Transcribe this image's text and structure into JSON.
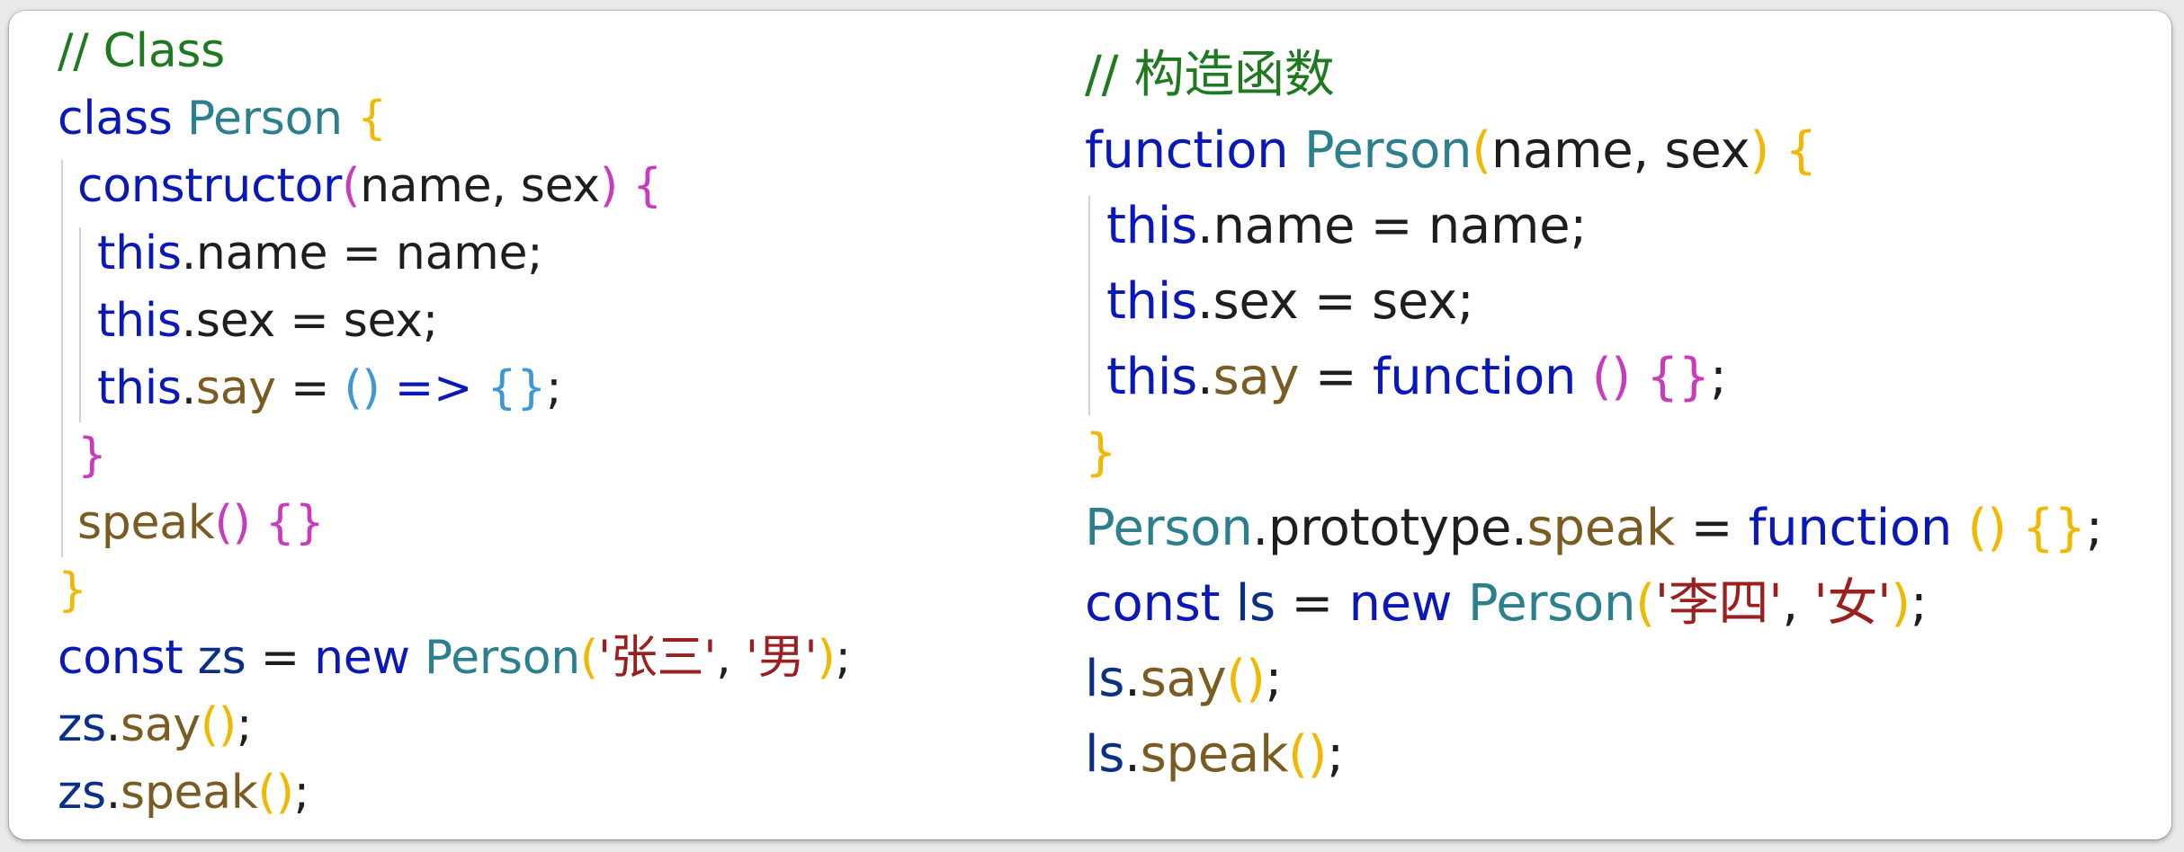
{
  "left_code": [
    {
      "indent": 0,
      "tokens": [
        {
          "t": "// Class",
          "c": "comment"
        }
      ]
    },
    {
      "indent": 0,
      "tokens": [
        {
          "t": "class ",
          "c": "keyword"
        },
        {
          "t": "Person ",
          "c": "class"
        },
        {
          "t": "{",
          "c": "brace-gold"
        }
      ]
    },
    {
      "indent": 1,
      "tokens": [
        {
          "t": "constructor",
          "c": "keyword"
        },
        {
          "t": "(",
          "c": "brace-pink"
        },
        {
          "t": "name, sex",
          "c": "plain"
        },
        {
          "t": ")",
          "c": "brace-pink"
        },
        {
          "t": " ",
          "c": "plain"
        },
        {
          "t": "{",
          "c": "brace-pink"
        }
      ]
    },
    {
      "indent": 2,
      "tokens": [
        {
          "t": "this",
          "c": "this"
        },
        {
          "t": ".name = name;",
          "c": "plain"
        }
      ]
    },
    {
      "indent": 2,
      "tokens": [
        {
          "t": "this",
          "c": "this"
        },
        {
          "t": ".sex = sex;",
          "c": "plain"
        }
      ]
    },
    {
      "indent": 2,
      "tokens": [
        {
          "t": "this",
          "c": "this"
        },
        {
          "t": ".",
          "c": "plain"
        },
        {
          "t": "say",
          "c": "function"
        },
        {
          "t": " = ",
          "c": "plain"
        },
        {
          "t": "()",
          "c": "brace-blue"
        },
        {
          "t": " => ",
          "c": "keyword"
        },
        {
          "t": "{}",
          "c": "brace-blue"
        },
        {
          "t": ";",
          "c": "plain"
        }
      ]
    },
    {
      "indent": 1,
      "tokens": [
        {
          "t": "}",
          "c": "brace-pink"
        }
      ]
    },
    {
      "indent": 1,
      "tokens": [
        {
          "t": "speak",
          "c": "function"
        },
        {
          "t": "()",
          "c": "brace-pink"
        },
        {
          "t": " ",
          "c": "plain"
        },
        {
          "t": "{}",
          "c": "brace-pink"
        }
      ]
    },
    {
      "indent": 0,
      "tokens": [
        {
          "t": "}",
          "c": "brace-gold"
        }
      ]
    },
    {
      "indent": 0,
      "tokens": [
        {
          "t": "const ",
          "c": "keyword"
        },
        {
          "t": "zs",
          "c": "variable"
        },
        {
          "t": " = ",
          "c": "plain"
        },
        {
          "t": "new ",
          "c": "keyword"
        },
        {
          "t": "Person",
          "c": "class"
        },
        {
          "t": "(",
          "c": "brace-gold"
        },
        {
          "t": "'张三'",
          "c": "string"
        },
        {
          "t": ", ",
          "c": "plain"
        },
        {
          "t": "'男'",
          "c": "string"
        },
        {
          "t": ")",
          "c": "brace-gold"
        },
        {
          "t": ";",
          "c": "plain"
        }
      ]
    },
    {
      "indent": 0,
      "tokens": [
        {
          "t": "zs",
          "c": "variable"
        },
        {
          "t": ".",
          "c": "plain"
        },
        {
          "t": "say",
          "c": "function"
        },
        {
          "t": "()",
          "c": "brace-gold"
        },
        {
          "t": ";",
          "c": "plain"
        }
      ]
    },
    {
      "indent": 0,
      "tokens": [
        {
          "t": "zs",
          "c": "variable"
        },
        {
          "t": ".",
          "c": "plain"
        },
        {
          "t": "speak",
          "c": "function"
        },
        {
          "t": "()",
          "c": "brace-gold"
        },
        {
          "t": ";",
          "c": "plain"
        }
      ]
    }
  ],
  "right_code": [
    {
      "indent": 0,
      "tokens": [
        {
          "t": "// 构造函数",
          "c": "comment"
        }
      ]
    },
    {
      "indent": 0,
      "tokens": [
        {
          "t": "function ",
          "c": "keyword"
        },
        {
          "t": "Person",
          "c": "class"
        },
        {
          "t": "(",
          "c": "brace-gold"
        },
        {
          "t": "name, sex",
          "c": "plain"
        },
        {
          "t": ")",
          "c": "brace-gold"
        },
        {
          "t": " ",
          "c": "plain"
        },
        {
          "t": "{",
          "c": "brace-gold"
        }
      ]
    },
    {
      "indent": 1,
      "tokens": [
        {
          "t": "this",
          "c": "this"
        },
        {
          "t": ".name = name;",
          "c": "plain"
        }
      ]
    },
    {
      "indent": 1,
      "tokens": [
        {
          "t": "this",
          "c": "this"
        },
        {
          "t": ".sex = sex;",
          "c": "plain"
        }
      ]
    },
    {
      "indent": 1,
      "tokens": [
        {
          "t": "this",
          "c": "this"
        },
        {
          "t": ".",
          "c": "plain"
        },
        {
          "t": "say",
          "c": "function"
        },
        {
          "t": " = ",
          "c": "plain"
        },
        {
          "t": "function ",
          "c": "keyword"
        },
        {
          "t": "()",
          "c": "brace-pink"
        },
        {
          "t": " ",
          "c": "plain"
        },
        {
          "t": "{}",
          "c": "brace-pink"
        },
        {
          "t": ";",
          "c": "plain"
        }
      ]
    },
    {
      "indent": 0,
      "tokens": [
        {
          "t": "}",
          "c": "brace-gold"
        }
      ]
    },
    {
      "indent": 0,
      "tokens": [
        {
          "t": "Person",
          "c": "class"
        },
        {
          "t": ".prototype.",
          "c": "plain"
        },
        {
          "t": "speak",
          "c": "function"
        },
        {
          "t": " = ",
          "c": "plain"
        },
        {
          "t": "function ",
          "c": "keyword"
        },
        {
          "t": "()",
          "c": "brace-gold"
        },
        {
          "t": " ",
          "c": "plain"
        },
        {
          "t": "{}",
          "c": "brace-gold"
        },
        {
          "t": ";",
          "c": "plain"
        }
      ]
    },
    {
      "indent": 0,
      "tokens": [
        {
          "t": "const ",
          "c": "keyword"
        },
        {
          "t": "ls",
          "c": "variable"
        },
        {
          "t": " = ",
          "c": "plain"
        },
        {
          "t": "new ",
          "c": "keyword"
        },
        {
          "t": "Person",
          "c": "class"
        },
        {
          "t": "(",
          "c": "brace-gold"
        },
        {
          "t": "'李四'",
          "c": "string"
        },
        {
          "t": ", ",
          "c": "plain"
        },
        {
          "t": "'女'",
          "c": "string"
        },
        {
          "t": ")",
          "c": "brace-gold"
        },
        {
          "t": ";",
          "c": "plain"
        }
      ]
    },
    {
      "indent": 0,
      "tokens": [
        {
          "t": "ls",
          "c": "variable"
        },
        {
          "t": ".",
          "c": "plain"
        },
        {
          "t": "say",
          "c": "function"
        },
        {
          "t": "()",
          "c": "brace-gold"
        },
        {
          "t": ";",
          "c": "plain"
        }
      ]
    },
    {
      "indent": 0,
      "tokens": [
        {
          "t": "ls",
          "c": "variable"
        },
        {
          "t": ".",
          "c": "plain"
        },
        {
          "t": "speak",
          "c": "function"
        },
        {
          "t": "()",
          "c": "brace-gold"
        },
        {
          "t": ";",
          "c": "plain"
        }
      ]
    }
  ]
}
